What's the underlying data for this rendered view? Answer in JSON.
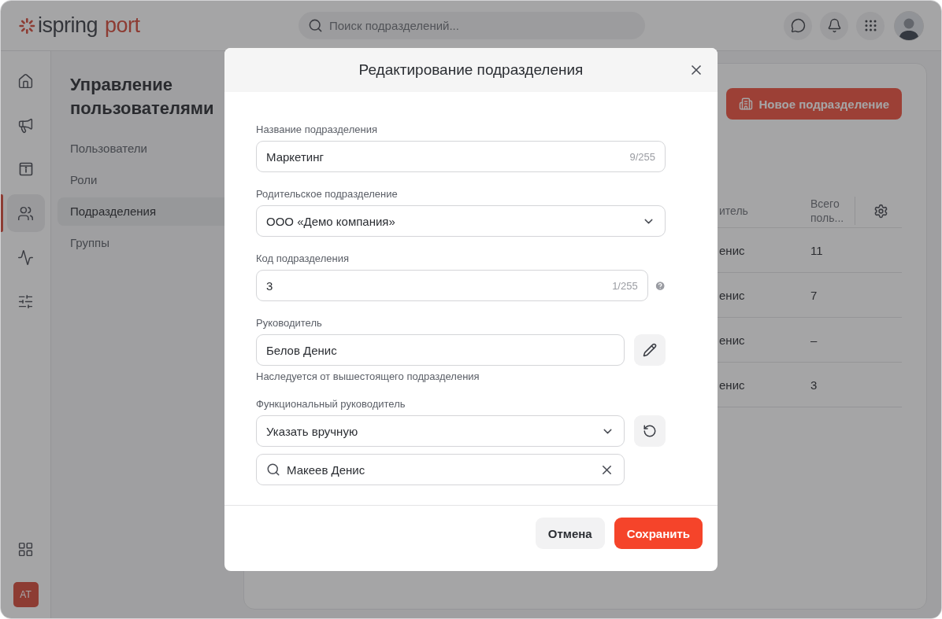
{
  "header": {
    "logo": {
      "brand": "ispring",
      "product": "port"
    },
    "search": {
      "placeholder": "Поиск подразделений..."
    },
    "actions": [
      {
        "kind": "chat"
      },
      {
        "kind": "bell"
      },
      {
        "kind": "apps"
      }
    ]
  },
  "rail": {
    "items": [
      {
        "kind": "home",
        "selected": false
      },
      {
        "kind": "megaphone",
        "selected": false
      },
      {
        "kind": "info",
        "selected": false
      },
      {
        "kind": "users",
        "selected": true
      },
      {
        "kind": "activity",
        "selected": false
      },
      {
        "kind": "sliders",
        "selected": false
      }
    ],
    "bottom_items": [
      {
        "kind": "apps-add"
      }
    ],
    "user_badge": "AT"
  },
  "nav": {
    "title": "Управление пользователями",
    "items": [
      {
        "label": "Пользователи",
        "selected": false
      },
      {
        "label": "Роли",
        "selected": false
      },
      {
        "label": "Подразделения",
        "selected": true
      },
      {
        "label": "Группы",
        "selected": false
      }
    ]
  },
  "page": {
    "new_button": "Новое подразделение",
    "table": {
      "columns": [
        "итель",
        "Всего поль..."
      ],
      "rows": [
        [
          "енис",
          "11"
        ],
        [
          "енис",
          "7"
        ],
        [
          "енис",
          "–"
        ],
        [
          "енис",
          "3"
        ]
      ]
    }
  },
  "dialog": {
    "title": "Редактирование подразделения",
    "fields": [
      {
        "label": "Название подразделения",
        "inputs": [
          {
            "kind": "text",
            "value": "Маркетинг",
            "counter": "9/255"
          }
        ]
      },
      {
        "label": "Родительское подразделение",
        "inputs": [
          {
            "kind": "select",
            "value": "ООО «Демо компания»"
          }
        ]
      },
      {
        "label": "Код подразделения",
        "help": true,
        "inputs": [
          {
            "kind": "text",
            "value": "3",
            "counter": "1/255"
          }
        ]
      },
      {
        "label": "Руководитель",
        "hint": "Наследуется от вышестоящего подразделения",
        "inputs": [
          {
            "kind": "text",
            "value": "Белов Денис",
            "button": {
              "kind": "edit"
            }
          }
        ]
      },
      {
        "label": "Функциональный руководитель",
        "inputs": [
          {
            "kind": "select",
            "value": "Указать вручную",
            "button": {
              "kind": "reset"
            }
          },
          {
            "kind": "search",
            "value": "Макеев Денис"
          }
        ]
      }
    ],
    "buttons": [
      {
        "label": "Отмена",
        "kind": "secondary"
      },
      {
        "label": "Сохранить",
        "kind": "primary"
      }
    ]
  }
}
